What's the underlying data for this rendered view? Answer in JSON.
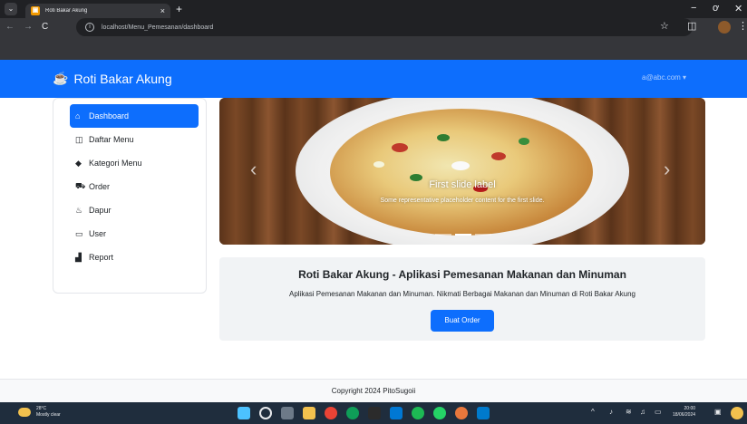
{
  "browser": {
    "tab_title": "Roti Bakar Akung",
    "tab_close": "×",
    "new_tab": "+",
    "url": "localhost/Menu_Pemesanan/dashboard",
    "back": "←",
    "forward": "→",
    "reload": "C",
    "info": "i",
    "star": "☆",
    "extensions": "◫",
    "menu_dots": "⋮",
    "minimize": "−",
    "maximize": "ơ",
    "close": "✕",
    "tab_menu": "⌄"
  },
  "navbar": {
    "brand": "Roti Bakar Akung",
    "brand_icon": "cup-icon",
    "user": "a@abc.com",
    "user_caret": "▾",
    "color": "#0d6efd"
  },
  "sidebar": {
    "items": [
      {
        "label": "Dashboard",
        "icon": "house-icon",
        "glyph": "⌂",
        "active": true
      },
      {
        "label": "Daftar Menu",
        "icon": "book-icon",
        "glyph": "◫",
        "active": false
      },
      {
        "label": "Kategori Menu",
        "icon": "tag-icon",
        "glyph": "◆",
        "active": false
      },
      {
        "label": "Order",
        "icon": "cart-icon",
        "glyph": "⛟",
        "active": false
      },
      {
        "label": "Dapur",
        "icon": "fire-icon",
        "glyph": "♨",
        "active": false
      },
      {
        "label": "User",
        "icon": "id-card-icon",
        "glyph": "▭",
        "active": false
      },
      {
        "label": "Report",
        "icon": "chart-icon",
        "glyph": "▟",
        "active": false
      }
    ]
  },
  "carousel": {
    "title": "First slide label",
    "text": "Some representative placeholder content for the first slide.",
    "prev": "‹",
    "next": "›"
  },
  "hero": {
    "title": "Roti Bakar Akung - Aplikasi Pemesanan Makanan dan Minuman",
    "text": "Aplikasi Pemesanan Makanan dan Minuman. Nikmati Berbagai Makanan dan Minuman di Roti Bakar Akung",
    "button": "Buat Order"
  },
  "footer": {
    "text": "Copyright 2024 PitoSugoii"
  },
  "taskbar": {
    "temp": "28°C",
    "weather": "Mostly clear",
    "time": "20:00",
    "date": "18/06/2024",
    "chevron": "^"
  }
}
